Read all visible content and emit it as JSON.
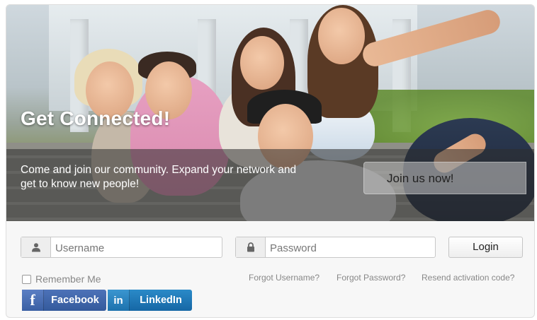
{
  "hero": {
    "title": "Get Connected!",
    "subtitle": "Come and join our community. Expand your network and get to know new people!",
    "join_label": "Join us now!"
  },
  "login_form": {
    "username": {
      "placeholder": "Username",
      "value": "",
      "icon": "user-icon"
    },
    "password": {
      "placeholder": "Password",
      "value": "",
      "icon": "lock-icon"
    },
    "login_label": "Login",
    "remember_label": "Remember Me",
    "remember_checked": false,
    "forgot_username": "Forgot Username?",
    "forgot_password": "Forgot Password?",
    "resend_activation": "Resend activation code?"
  },
  "social": {
    "facebook": {
      "label": "Facebook",
      "icon": "f",
      "color": "#3b5998"
    },
    "linkedin": {
      "label": "LinkedIn",
      "icon": "in",
      "color": "#1a75b5"
    }
  }
}
